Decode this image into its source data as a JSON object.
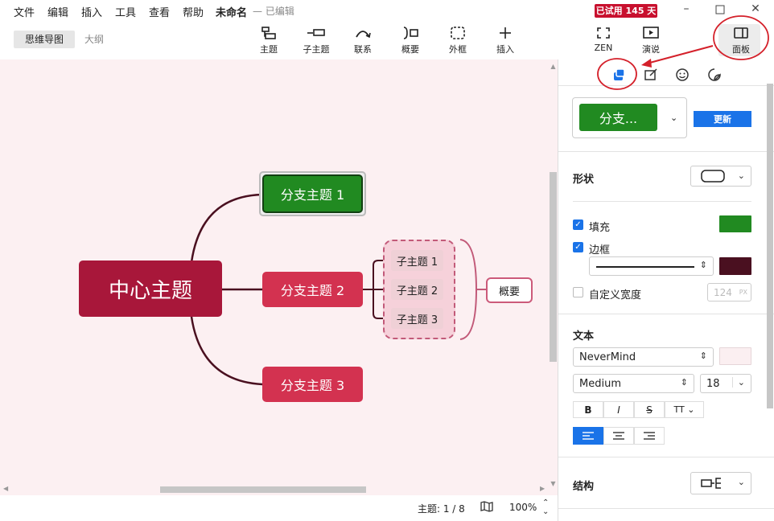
{
  "menubar": {
    "items": [
      "文件",
      "编辑",
      "插入",
      "工具",
      "查看",
      "帮助"
    ],
    "doc_title": "未命名",
    "doc_status": "— 已编辑",
    "trial_badge": "已试用 145 天",
    "window_controls": [
      "minimize",
      "maximize",
      "close"
    ]
  },
  "toolbar": {
    "tabs": [
      {
        "label": "思维导图",
        "active": true
      },
      {
        "label": "大纲",
        "active": false
      }
    ],
    "tools": [
      {
        "label": "主题",
        "icon": "topic-icon"
      },
      {
        "label": "子主题",
        "icon": "subtopic-icon"
      },
      {
        "label": "联系",
        "icon": "relationship-icon"
      },
      {
        "label": "概要",
        "icon": "summary-icon"
      },
      {
        "label": "外框",
        "icon": "boundary-icon"
      },
      {
        "label": "插入",
        "icon": "plus-icon"
      }
    ],
    "right_tools": [
      {
        "label": "ZEN",
        "icon": "zen-icon"
      },
      {
        "label": "演说",
        "icon": "present-icon"
      },
      {
        "label": "面板",
        "icon": "panel-icon"
      }
    ]
  },
  "canvas": {
    "central_topic": "中心主题",
    "branches": [
      "分支主题 1",
      "分支主题 2",
      "分支主题 3"
    ],
    "subtopics": [
      "子主题 1",
      "子主题 2",
      "子主题 3"
    ],
    "summary": "概要",
    "colors": {
      "background": "#fcf0f2",
      "central": "#a8173a",
      "branch_selected": "#218a21",
      "branch": "#d33250",
      "line": "#4a1020"
    }
  },
  "statusbar": {
    "topic_count": "主题: 1 / 8",
    "zoom": "100%"
  },
  "panel": {
    "tabs": [
      "style-icon",
      "format-icon",
      "emoji-icon",
      "sticker-icon"
    ],
    "active_tab": "style-icon",
    "style_preview": "分支...",
    "update_button": "更新",
    "shape_label": "形状",
    "fill_label": "填充",
    "fill_checked": true,
    "fill_color": "#218a21",
    "border_label": "边框",
    "border_checked": true,
    "border_color": "#4a1020",
    "custom_width_label": "自定义宽度",
    "custom_width_checked": false,
    "custom_width_value": "124",
    "custom_width_unit": "PX",
    "text_label": "文本",
    "font_family": "NeverMind",
    "font_weight": "Medium",
    "font_size": "18",
    "text_color": "#fbeff1",
    "format_buttons": [
      "B",
      "I",
      "S",
      "TT"
    ],
    "align": "left",
    "structure_label": "结构"
  },
  "accent": {
    "annotation_red": "#d4202a",
    "primary_blue": "#1a73e8"
  }
}
